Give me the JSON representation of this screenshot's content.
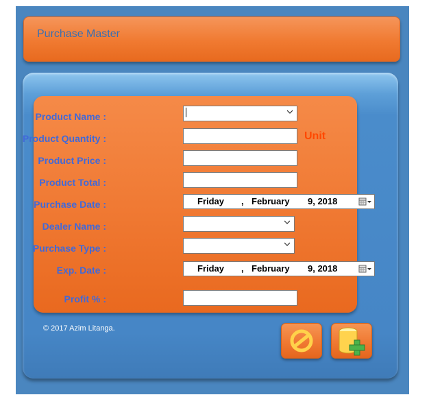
{
  "header": {
    "title": "Purchase Master"
  },
  "form": {
    "fields": [
      {
        "label": "Product Name :",
        "type": "combo",
        "value": ""
      },
      {
        "label": "Product Quantity :",
        "type": "text",
        "value": ""
      },
      {
        "label": "Product Price :",
        "type": "text",
        "value": ""
      },
      {
        "label": "Product Total :",
        "type": "text",
        "value": ""
      },
      {
        "label": "Purchase Date :",
        "type": "date",
        "day": "Friday",
        "sep": ",",
        "month": "February",
        "date": "9, 2018"
      },
      {
        "label": "Dealer Name :",
        "type": "combo",
        "value": ""
      },
      {
        "label": "Purchase Type :",
        "type": "combo",
        "value": ""
      },
      {
        "label": "Exp. Date :",
        "type": "date",
        "day": "Friday",
        "sep": ",",
        "month": "February",
        "date": "9, 2018"
      },
      {
        "label": "Profit % :",
        "type": "text",
        "value": ""
      }
    ],
    "unit_label": "Unit"
  },
  "footer": {
    "copyright": "© 2017 Azim Litanga.",
    "cancel_icon": "cancel-icon",
    "add_icon": "add-database-icon"
  },
  "colors": {
    "window_bg": "#4a86bf",
    "orange": "#f07a31",
    "label_blue": "#4169d9",
    "unit_red": "#ff4800"
  }
}
